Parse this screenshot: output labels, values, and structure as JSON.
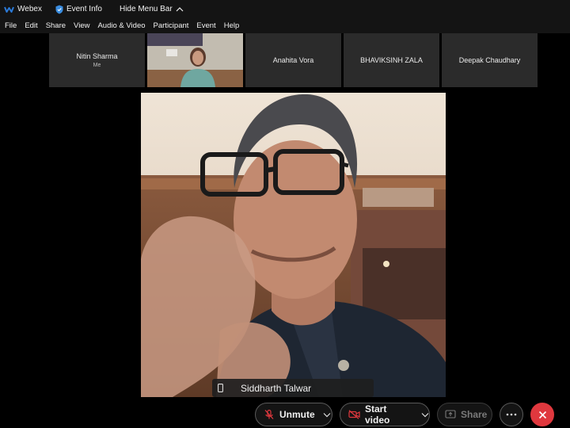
{
  "titlebar": {
    "app_name": "Webex",
    "event_info": "Event Info",
    "hide_menu": "Hide Menu Bar"
  },
  "menu": [
    "File",
    "Edit",
    "Share",
    "View",
    "Audio & Video",
    "Participant",
    "Event",
    "Help"
  ],
  "participants": [
    {
      "name": "Nitin Sharma",
      "sub": "Me"
    },
    {
      "name": "",
      "sub": ""
    },
    {
      "name": "Anahita Vora",
      "sub": ""
    },
    {
      "name": "BHAVIKSINH ZALA",
      "sub": ""
    },
    {
      "name": "Deepak Chaudhary",
      "sub": ""
    }
  ],
  "speaker": {
    "name": "Siddharth Talwar"
  },
  "controls": {
    "unmute": "Unmute",
    "start_video": "Start video",
    "share": "Share"
  },
  "colors": {
    "leave": "#e0383e",
    "webex_blue": "#2b7ad8"
  }
}
